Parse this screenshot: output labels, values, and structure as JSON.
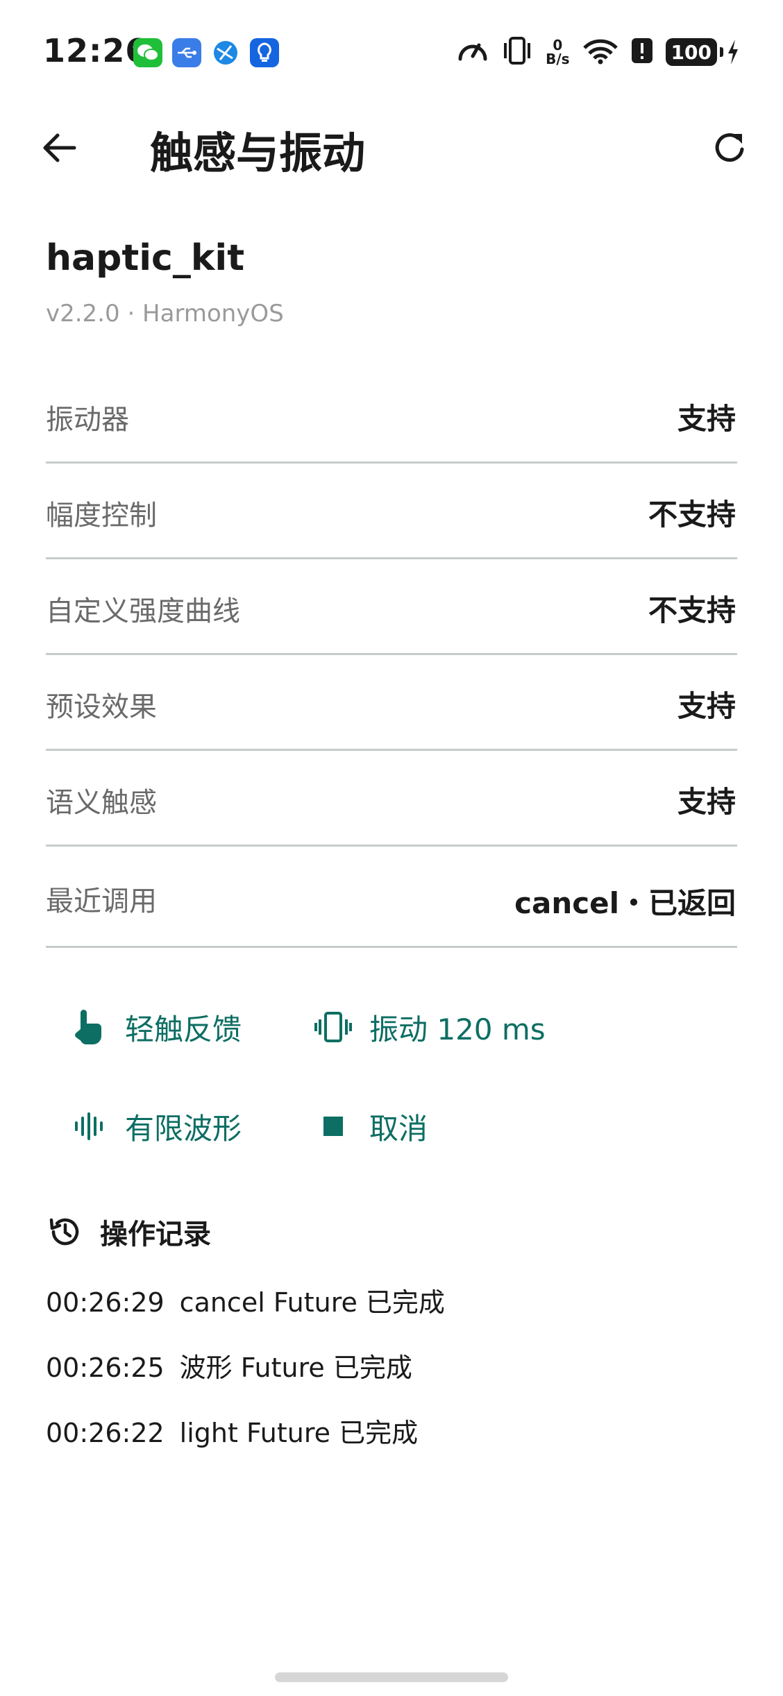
{
  "status_bar": {
    "time": "12:26",
    "notification_icons": [
      "wechat-icon",
      "usb-icon",
      "browser-icon",
      "tips-icon"
    ],
    "net_speed_top": "0",
    "net_speed_unit": "B/s",
    "battery": "100"
  },
  "app_bar": {
    "title": "触感与振动"
  },
  "kit": {
    "name": "haptic_kit",
    "meta": "v2.2.0 · HarmonyOS"
  },
  "capabilities": [
    {
      "label": "振动器",
      "value": "支持"
    },
    {
      "label": "幅度控制",
      "value": "不支持"
    },
    {
      "label": "自定义强度曲线",
      "value": "不支持"
    },
    {
      "label": "预设效果",
      "value": "支持"
    },
    {
      "label": "语义触感",
      "value": "支持"
    },
    {
      "label": "最近调用",
      "value": "cancel・已返回"
    }
  ],
  "actions": {
    "light": "轻触反馈",
    "vibrate": "振动 120 ms",
    "waveform": "有限波形",
    "cancel": "取消"
  },
  "log": {
    "title": "操作记录",
    "items": [
      {
        "time": "00:26:29",
        "text": "cancel Future 已完成"
      },
      {
        "time": "00:26:25",
        "text": "波形 Future 已完成"
      },
      {
        "time": "00:26:22",
        "text": "light Future 已完成"
      }
    ]
  },
  "colors": {
    "accent": "#0d6e63",
    "divider": "#c6cccc",
    "secondary_text": "#6a6a6a",
    "meta_text": "#9a9a9a"
  }
}
